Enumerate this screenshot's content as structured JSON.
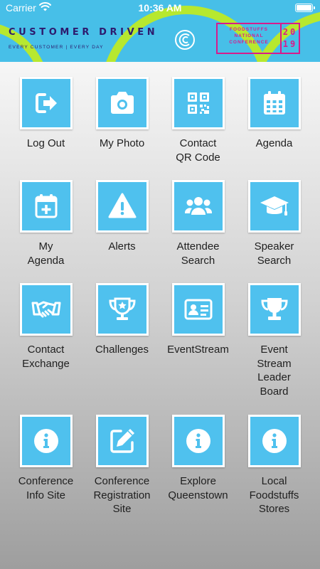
{
  "status_bar": {
    "carrier": "Carrier",
    "time": "10:36 AM"
  },
  "banner": {
    "title": "CUSTOMER DRIVEN",
    "subtitle": "EVERY CUSTOMER | EVERY DAY",
    "conference_text": "FOODSTUFFS NATIONAL CONFERENCE",
    "year_top": "20",
    "year_bottom": "19"
  },
  "tiles": [
    {
      "label": "Log Out",
      "icon": "logout-icon"
    },
    {
      "label": "My Photo",
      "icon": "camera-icon"
    },
    {
      "label": "Contact\nQR Code",
      "icon": "qr-code-icon"
    },
    {
      "label": "Agenda",
      "icon": "calendar-icon"
    },
    {
      "label": "My\nAgenda",
      "icon": "calendar-plus-icon"
    },
    {
      "label": "Alerts",
      "icon": "warning-icon"
    },
    {
      "label": "Attendee\nSearch",
      "icon": "users-icon"
    },
    {
      "label": "Speaker\nSearch",
      "icon": "graduation-cap-icon"
    },
    {
      "label": "Contact\nExchange",
      "icon": "handshake-icon"
    },
    {
      "label": "Challenges",
      "icon": "trophy-star-icon"
    },
    {
      "label": "EventStream",
      "icon": "id-card-icon"
    },
    {
      "label": "Event\nStream\nLeader\nBoard",
      "icon": "trophy-icon"
    },
    {
      "label": "Conference\nInfo Site",
      "icon": "info-icon"
    },
    {
      "label": "Conference\nRegistration\nSite",
      "icon": "edit-icon"
    },
    {
      "label": "Explore\nQueenstown",
      "icon": "info-icon"
    },
    {
      "label": "Local\nFoodstuffs\nStores",
      "icon": "info-icon"
    }
  ],
  "colors": {
    "tile_bg": "#4fc1ee",
    "header_bg": "#47bfe8",
    "accent_lime": "#b7e82f",
    "accent_pink": "#d81b8c",
    "brand_navy": "#2d1b6e"
  }
}
